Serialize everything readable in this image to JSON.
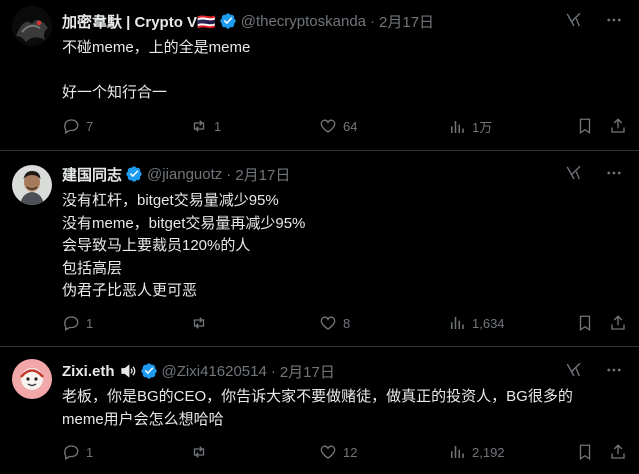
{
  "tweets": [
    {
      "display_name": "加密韋馱 | Crypto V🇹🇭",
      "handle": "@thecryptoskanda",
      "sep": "·",
      "date": "2月17日",
      "verified": true,
      "lines": [
        "不碰meme，上的全是meme",
        "",
        "好一个知行合一"
      ],
      "stats": {
        "replies": "7",
        "reposts": "1",
        "likes": "64",
        "views": "1万"
      }
    },
    {
      "display_name": "建国同志",
      "handle": "@jianguotz",
      "sep": "·",
      "date": "2月17日",
      "verified": true,
      "lines": [
        "没有杠杆，bitget交易量减少95%",
        "没有meme，bitget交易量再减少95%",
        "会导致马上要裁员120%的人",
        "包括高层",
        "伪君子比恶人更可恶"
      ],
      "stats": {
        "replies": "1",
        "reposts": "",
        "likes": "8",
        "views": "1,634"
      }
    },
    {
      "display_name": "Zixi.eth",
      "handle": "@Zixi41620514",
      "sep": "·",
      "date": "2月17日",
      "verified": true,
      "lines": [
        "老板，你是BG的CEO，你告诉大家不要做赌徒，做真正的投资人，BG很多的",
        "meme用户会怎么想哈哈"
      ],
      "stats": {
        "replies": "1",
        "reposts": "",
        "likes": "12",
        "views": "2,192"
      }
    }
  ],
  "colors": {
    "background": "#000000",
    "text": "#e7e9ea",
    "muted": "#71767b",
    "verified": "#1d9bf0",
    "divider": "#2f3336"
  },
  "icons": [
    "reply-icon",
    "repost-icon",
    "like-icon",
    "views-icon",
    "bookmark-icon",
    "share-icon",
    "grok-icon",
    "more-icon",
    "verified-icon",
    "speaker-icon"
  ]
}
